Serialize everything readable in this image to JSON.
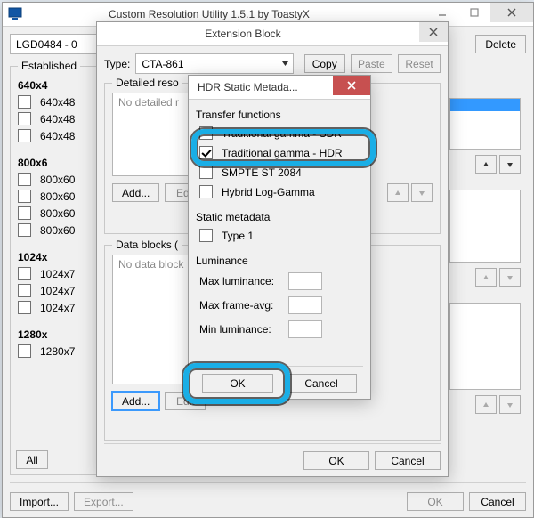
{
  "main": {
    "title": "Custom Resolution Utility 1.5.1 by ToastyX",
    "display_combo": "LGD0484 - 0",
    "buttons": {
      "delete": "Delete"
    },
    "established": {
      "legend": "Established",
      "rows": [
        {
          "label": "640x4",
          "bold": true
        },
        {
          "label": "640x48",
          "bold": false
        },
        {
          "label": "640x48",
          "bold": false
        },
        {
          "label": "640x48",
          "bold": false
        },
        {
          "label": "",
          "spacer": true
        },
        {
          "label": "800x6",
          "bold": true
        },
        {
          "label": "800x60",
          "bold": false
        },
        {
          "label": "800x60",
          "bold": false
        },
        {
          "label": "800x60",
          "bold": false
        },
        {
          "label": "800x60",
          "bold": false
        },
        {
          "label": "",
          "spacer": true
        },
        {
          "label": "1024x",
          "bold": true
        },
        {
          "label": "1024x7",
          "bold": false
        },
        {
          "label": "1024x7",
          "bold": false
        },
        {
          "label": "1024x7",
          "bold": false
        },
        {
          "label": "",
          "spacer": true
        },
        {
          "label": "1280x",
          "bold": true
        },
        {
          "label": "1280x7",
          "bold": false
        }
      ],
      "all_btn": "All"
    },
    "footer": {
      "import": "Import...",
      "export": "Export...",
      "ok": "OK",
      "cancel": "Cancel"
    }
  },
  "ext": {
    "title": "Extension Block",
    "type_label": "Type:",
    "type_value": "CTA-861",
    "copy": "Copy",
    "paste": "Paste",
    "reset": "Reset",
    "detailed": {
      "legend": "Detailed reso",
      "placeholder": "No detailed r",
      "add": "Add...",
      "edit": "Edit"
    },
    "datablocks": {
      "legend": "Data blocks (",
      "placeholder": "No data block",
      "add": "Add...",
      "edit": "Edit"
    },
    "ok": "OK",
    "cancel": "Cancel"
  },
  "hdr": {
    "title": "HDR Static Metada...",
    "transfer_legend": "Transfer functions",
    "opts": {
      "sdr": "Traditional gamma - SDR",
      "hdr": "Traditional gamma - HDR",
      "smpte": "SMPTE ST 2084",
      "hlg": "Hybrid Log-Gamma"
    },
    "static_legend": "Static metadata",
    "type1": "Type 1",
    "lum_legend": "Luminance",
    "max_lum": "Max luminance:",
    "max_avg": "Max frame-avg:",
    "min_lum": "Min luminance:",
    "ok": "OK",
    "cancel": "Cancel"
  },
  "right_col": {}
}
